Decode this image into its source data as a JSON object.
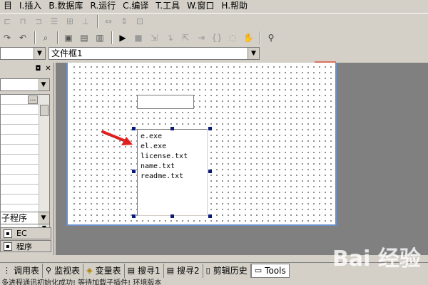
{
  "menu": [
    {
      "key": "I",
      "label": "I.插入"
    },
    {
      "key": "B",
      "label": "B.数据库"
    },
    {
      "key": "R",
      "label": "R.运行"
    },
    {
      "key": "C",
      "label": "C.编译"
    },
    {
      "key": "T",
      "label": "T.工具"
    },
    {
      "key": "W",
      "label": "W.窗口"
    },
    {
      "key": "H",
      "label": "H.帮助"
    }
  ],
  "combo_row": {
    "left_combo_value": "",
    "right_combo_value": "文件框1"
  },
  "left_panel": {
    "sub_program_combo": "子程序",
    "tabs": [
      {
        "label": "EC",
        "icon": "ec-icon"
      },
      {
        "label": "程序",
        "icon": "program-icon"
      }
    ]
  },
  "listbox": {
    "items": [
      "e.exe",
      "el.exe",
      "license.txt",
      "name.txt",
      "readme.txt"
    ]
  },
  "bottom_tabs": [
    {
      "label": "调用表",
      "icon": "grid-icon"
    },
    {
      "label": "监视表",
      "icon": "search-icon"
    },
    {
      "label": "变量表",
      "icon": "variable-icon"
    },
    {
      "label": "搜寻1",
      "icon": "find-icon"
    },
    {
      "label": "搜寻2",
      "icon": "find-icon"
    },
    {
      "label": "剪辑历史",
      "icon": "clip-icon"
    },
    {
      "label": "Tools",
      "icon": "tools-icon"
    }
  ],
  "status_text": "多进程通讯初始化成功! 等待加载子插件! 环境版本",
  "watermark": "Bai 经验",
  "colors": {
    "handle": "#0a1a78",
    "arrow": "#e02020",
    "form_border": "#6b8fc9"
  }
}
